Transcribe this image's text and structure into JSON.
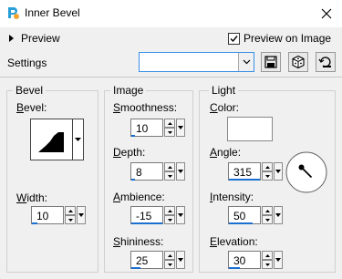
{
  "window": {
    "title": "Inner Bevel"
  },
  "preview": {
    "toggle_label": "Preview",
    "preview_on_image_label": "Preview on Image",
    "preview_on_image_checked": true
  },
  "settings": {
    "label": "Settings",
    "preset_value": ""
  },
  "bevel_group": {
    "title": "Bevel",
    "bevel_label_first": "B",
    "bevel_label_rest": "evel:",
    "width_label_first": "W",
    "width_label_rest": "idth:",
    "width_value": "10"
  },
  "image_group": {
    "title": "Image",
    "smoothness_first": "S",
    "smoothness_rest": "moothness:",
    "smoothness_value": "10",
    "depth_first": "D",
    "depth_rest": "epth:",
    "depth_value": "8",
    "ambience_first": "A",
    "ambience_rest": "mbience:",
    "ambience_value": "-15",
    "shininess_first": "S",
    "shininess_rest": "hininess:",
    "shininess_value": "25"
  },
  "light_group": {
    "title": "Light",
    "color_first": "C",
    "color_rest": "olor:",
    "color_value": "#ffffff",
    "angle_first": "A",
    "angle_rest": "ngle:",
    "angle_value": "315",
    "intensity_first": "I",
    "intensity_rest": "ntensity:",
    "intensity_value": "50",
    "elevation_first": "E",
    "elevation_rest": "levation:",
    "elevation_value": "30"
  },
  "colors": {
    "accent": "#1a6fd1",
    "focus_border": "#3a8ee6"
  },
  "icons": {
    "app": "paintshop-icon",
    "close": "close-icon",
    "save": "save-preset-icon",
    "random": "dice-icon",
    "reset": "reset-icon",
    "dropdown": "chevron-down-icon"
  }
}
